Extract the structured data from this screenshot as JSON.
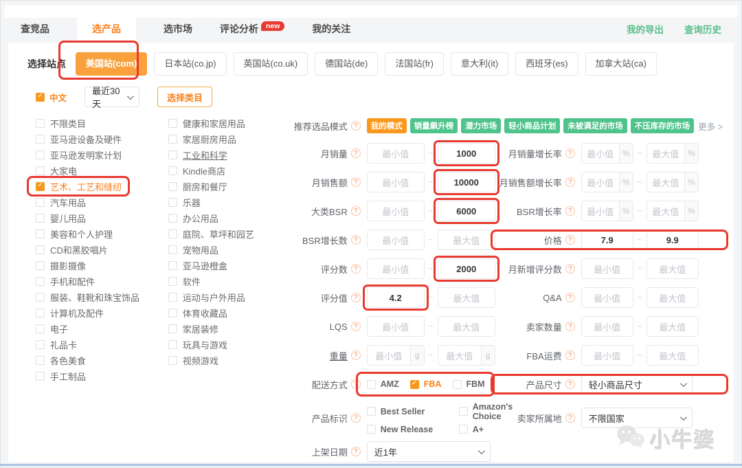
{
  "colors": {
    "accent_orange": "#f9981d",
    "tag_green": "#4ec38b",
    "annotation_red": "#e8392e",
    "link_green": "#5abf8a"
  },
  "nav": {
    "tabs": [
      {
        "key": "competitor",
        "label": "查竞品"
      },
      {
        "key": "product",
        "label": "选产品",
        "active": true
      },
      {
        "key": "market",
        "label": "选市场"
      },
      {
        "key": "review-analysis",
        "label": "评论分析",
        "badge": "new"
      },
      {
        "key": "watchlist",
        "label": "我的关注"
      }
    ],
    "links": [
      {
        "key": "my-exports",
        "label": "我的导出"
      },
      {
        "key": "query-history",
        "label": "查询历史"
      }
    ]
  },
  "site": {
    "label": "选择站点",
    "options": [
      {
        "key": "us",
        "label": "美国站(com)",
        "active": true
      },
      {
        "key": "jp",
        "label": "日本站(co.jp)"
      },
      {
        "key": "uk",
        "label": "英国站(co.uk)"
      },
      {
        "key": "de",
        "label": "德国站(de)"
      },
      {
        "key": "fr",
        "label": "法国站(fr)"
      },
      {
        "key": "it",
        "label": "意大利(it)"
      },
      {
        "key": "es",
        "label": "西班牙(es)"
      },
      {
        "key": "ca",
        "label": "加拿大站(ca)"
      }
    ]
  },
  "quick": {
    "chinese_label": "中文",
    "chinese_checked": true,
    "date_range": "最近30天",
    "category_button": "选择类目"
  },
  "categories": {
    "col1": [
      {
        "label": "不限类目"
      },
      {
        "label": "亚马逊设备及硬件"
      },
      {
        "label": "亚马逊发明家计划"
      },
      {
        "label": "大家电"
      },
      {
        "label": "艺术、工艺和缝纫",
        "checked": true,
        "annotated": true
      },
      {
        "label": "汽车用品"
      },
      {
        "label": "婴儿用品"
      },
      {
        "label": "美容和个人护理"
      },
      {
        "label": "CD和黑胶唱片"
      },
      {
        "label": "摄影摄像"
      },
      {
        "label": "手机和配件"
      },
      {
        "label": "服装、鞋靴和珠宝饰品"
      },
      {
        "label": "计算机及配件"
      },
      {
        "label": "电子"
      },
      {
        "label": "礼品卡"
      },
      {
        "label": "各色美食"
      },
      {
        "label": "手工制品"
      }
    ],
    "col2": [
      {
        "label": "健康和家居用品"
      },
      {
        "label": "家居厨房用品"
      },
      {
        "label": "工业和科学",
        "underline": true
      },
      {
        "label": "Kindle商店"
      },
      {
        "label": "厨房和餐厅"
      },
      {
        "label": "乐器"
      },
      {
        "label": "办公用品"
      },
      {
        "label": "庭院、草坪和园艺"
      },
      {
        "label": "宠物用品"
      },
      {
        "label": "亚马逊橙盒"
      },
      {
        "label": "软件"
      },
      {
        "label": "运动与户外用品"
      },
      {
        "label": "体育收藏品"
      },
      {
        "label": "家居装修"
      },
      {
        "label": "玩具与游戏"
      },
      {
        "label": "视频游戏"
      }
    ]
  },
  "modes": {
    "label": "推荐选品模式",
    "tags": [
      {
        "label": "我的模式",
        "color": "orange"
      },
      {
        "label": "销量飙升榜",
        "color": "green"
      },
      {
        "label": "潜力市场",
        "color": "green"
      },
      {
        "label": "轻小商品计划",
        "color": "green"
      },
      {
        "label": "未被满足的市场",
        "color": "green"
      },
      {
        "label": "不压库存的市场",
        "color": "green"
      }
    ],
    "more": "更多 >"
  },
  "form": {
    "min_placeholder": "最小值",
    "max_placeholder": "最大值",
    "rows": [
      {
        "left": {
          "type": "range",
          "key": "monthly-sales",
          "label": "月销量",
          "min": "",
          "max": "1000",
          "annotate": "max"
        },
        "right": {
          "type": "range",
          "key": "monthly-sales-growth",
          "label": "月销量增长率",
          "suffix": "%"
        }
      },
      {
        "left": {
          "type": "range",
          "key": "monthly-revenue",
          "label": "月销售额",
          "min": "",
          "max": "10000",
          "annotate": "max"
        },
        "right": {
          "type": "range",
          "key": "monthly-revenue-growth",
          "label": "月销售额增长率",
          "suffix": "%"
        }
      },
      {
        "left": {
          "type": "range",
          "key": "category-bsr",
          "label": "大类BSR",
          "min": "",
          "max": "6000",
          "annotate": "max"
        },
        "right": {
          "type": "range",
          "key": "bsr-growth-rate",
          "label": "BSR增长率",
          "suffix": "%"
        }
      },
      {
        "left": {
          "type": "range",
          "key": "bsr-growth-count",
          "label": "BSR增长数"
        },
        "right": {
          "type": "range",
          "key": "price",
          "label": "价格",
          "min": "7.9",
          "max": "9.9",
          "annotate": "row"
        }
      },
      {
        "left": {
          "type": "range",
          "key": "rating-count",
          "label": "评分数",
          "min": "",
          "max": "2000",
          "annotate": "max"
        },
        "right": {
          "type": "range",
          "key": "monthly-new-ratings",
          "label": "月新增评分数"
        }
      },
      {
        "left": {
          "type": "range",
          "key": "rating-value",
          "label": "评分值",
          "min": "4.2",
          "max": "",
          "annotate": "min"
        },
        "right": {
          "type": "range",
          "key": "qa",
          "label": "Q&A"
        }
      },
      {
        "left": {
          "type": "range",
          "key": "lqs",
          "label": "LQS"
        },
        "right": {
          "type": "range",
          "key": "seller-count",
          "label": "卖家数量"
        }
      },
      {
        "left": {
          "type": "range",
          "key": "weight",
          "label": "重量",
          "suffix": "g",
          "underline": true
        },
        "right": {
          "type": "range",
          "key": "fba-fee",
          "label": "FBA运费"
        }
      },
      {
        "left": {
          "type": "checks",
          "key": "delivery-method",
          "label": "配送方式",
          "annotate": "group",
          "options": [
            {
              "label": "AMZ"
            },
            {
              "label": "FBA",
              "checked": true
            },
            {
              "label": "FBM"
            }
          ]
        },
        "right": {
          "type": "select",
          "key": "product-size",
          "label": "产品尺寸",
          "value": "轻小商品尺寸",
          "annotate": "row"
        }
      },
      {
        "tall": true,
        "left": {
          "type": "checkgrid",
          "key": "product-badge",
          "label": "产品标识",
          "options": [
            {
              "label": "Best Seller"
            },
            {
              "label": "Amazon's Choice"
            },
            {
              "label": "New Release"
            },
            {
              "label": "A+"
            }
          ]
        },
        "right": {
          "type": "select",
          "key": "seller-location",
          "label": "卖家所属地",
          "value": "不限国家"
        }
      },
      {
        "left": {
          "type": "select",
          "key": "listing-date",
          "label": "上架日期",
          "value": "近1年"
        },
        "right": null
      }
    ]
  },
  "watermark": {
    "text": "小牛婆"
  }
}
